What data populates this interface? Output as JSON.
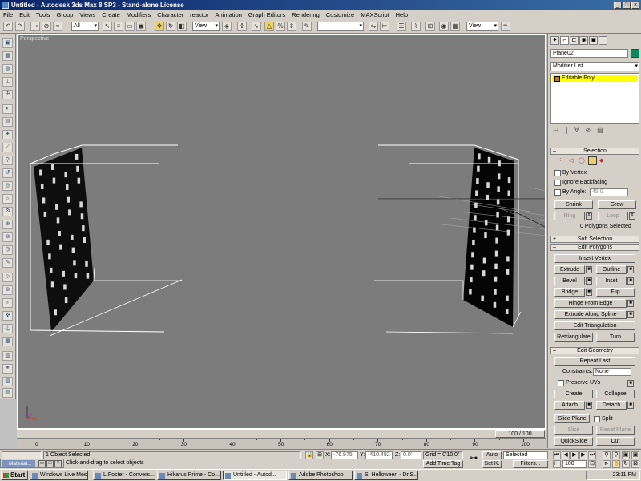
{
  "window": {
    "title": "Untitled - Autodesk 3ds Max 8 SP3  - Stand-alone License",
    "buttons": [
      "_",
      "□",
      "×"
    ]
  },
  "menu": [
    "File",
    "Edit",
    "Tools",
    "Group",
    "Views",
    "Create",
    "Modifiers",
    "Character",
    "reactor",
    "Animation",
    "Graph Editors",
    "Rendering",
    "Customize",
    "MAXScript",
    "Help"
  ],
  "toolbar": {
    "selection_filter": "All",
    "ref_coord": "View",
    "named_sel": "",
    "view_dropdown2": "View"
  },
  "viewport": {
    "label": "Perspective"
  },
  "command_panel": {
    "object_name": "Plane02",
    "object_color": "#0a8a60",
    "modifier_list": "Modifier List",
    "stack_item": "Editable Poly",
    "selection": {
      "title": "Selection",
      "by_vertex": "By Vertex",
      "ignore_backfacing": "Ignore Backfacing",
      "by_angle": "By Angle:",
      "angle_value": "45.0",
      "shrink": "Shrink",
      "grow": "Grow",
      "ring": "Ring",
      "loop": "Loop",
      "status": "0 Polygons Selected"
    },
    "soft_selection": {
      "title": "Soft Selection"
    },
    "edit_polygons": {
      "title": "Edit Polygons",
      "insert_vertex": "Insert Vertex",
      "extrude": "Extrude",
      "outline": "Outline",
      "bevel": "Bevel",
      "inset": "Inset",
      "bridge": "Bridge",
      "flip": "Flip",
      "hinge_from_edge": "Hinge From Edge",
      "extrude_along_spline": "Extrude Along Spline",
      "edit_triangulation": "Edit Triangulation",
      "retriangulate": "Retriangulate",
      "turn": "Turn"
    },
    "edit_geometry": {
      "title": "Edit Geometry",
      "repeat_last": "Repeat Last",
      "constraints_label": "Constraints:",
      "constraints_value": "None",
      "preserve_uvs": "Preserve UVs",
      "create": "Create",
      "collapse": "Collapse",
      "attach": "Attach",
      "detach": "Detach",
      "slice_plane": "Slice Plane",
      "split": "Split",
      "slice": "Slice",
      "reset_plane": "Reset Plane",
      "quickslice": "QuickSlice",
      "cut": "Cut"
    }
  },
  "timeline": {
    "frame_display": "100 / 100",
    "ticks": [
      "0",
      "10",
      "20",
      "30",
      "40",
      "50",
      "60",
      "70",
      "80",
      "90",
      "100"
    ]
  },
  "status": {
    "selected": "1 Object Selected",
    "prompt": "Click-and-drag to select objects",
    "x_label": "X:",
    "x_value": "-76.975'",
    "y_label": "Y:",
    "y_value": "-410.492",
    "z_label": "Z:",
    "z_value": "0.0'",
    "grid": "Grid = 0'10.0\"",
    "add_time_tag": "Add Time Tag",
    "auto_key": "Auto",
    "set_key": "Set K.",
    "selected_dropdown": "Selected",
    "filters": "Filters...",
    "frame_field": "100"
  },
  "mini_window": {
    "title": "Material..."
  },
  "taskbar": {
    "start": "Start",
    "tasks": [
      "Windows Live Mes...",
      "L.Foster - Convers...",
      "Hikarus Prime - Co...",
      "Untitled - Autod...",
      "Adobe Photoshop",
      "S. Helloween - Dr.S..."
    ],
    "active_index": 3,
    "clock": "23:11 PM"
  }
}
